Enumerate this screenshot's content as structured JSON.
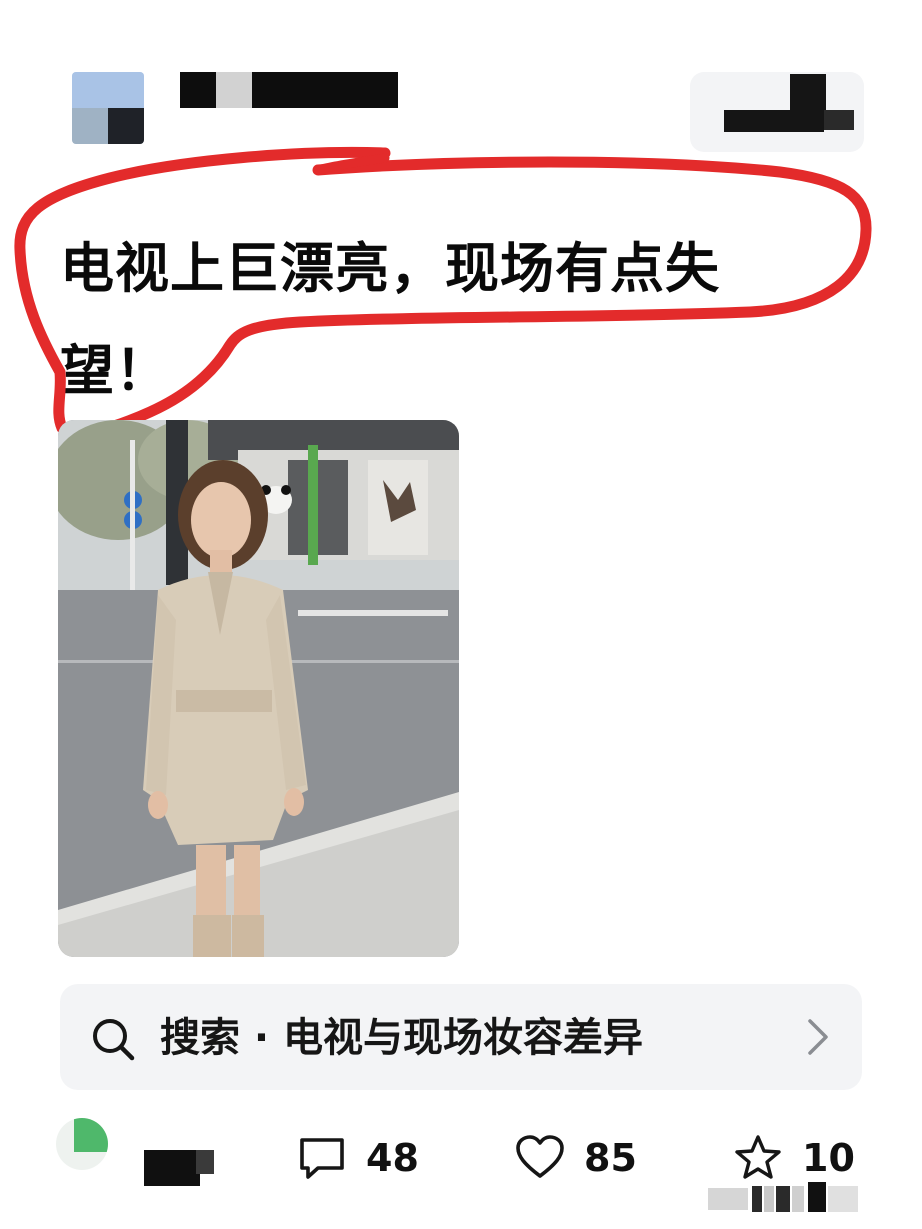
{
  "post": {
    "text": "电视上巨漂亮，现场有点失望！"
  },
  "search": {
    "label": "搜索 · 电视与现场妆容差异"
  },
  "stats": {
    "comments": "48",
    "likes": "85",
    "favorites": "10"
  },
  "colors": {
    "highlight_circle": "#e32b2b",
    "search_bg": "#f3f4f6",
    "text": "#0a0a0a"
  },
  "icons": {
    "search": "search-icon",
    "chevron": "chevron-right-icon",
    "comment": "comment-icon",
    "like": "heart-icon",
    "favorite": "star-icon"
  }
}
